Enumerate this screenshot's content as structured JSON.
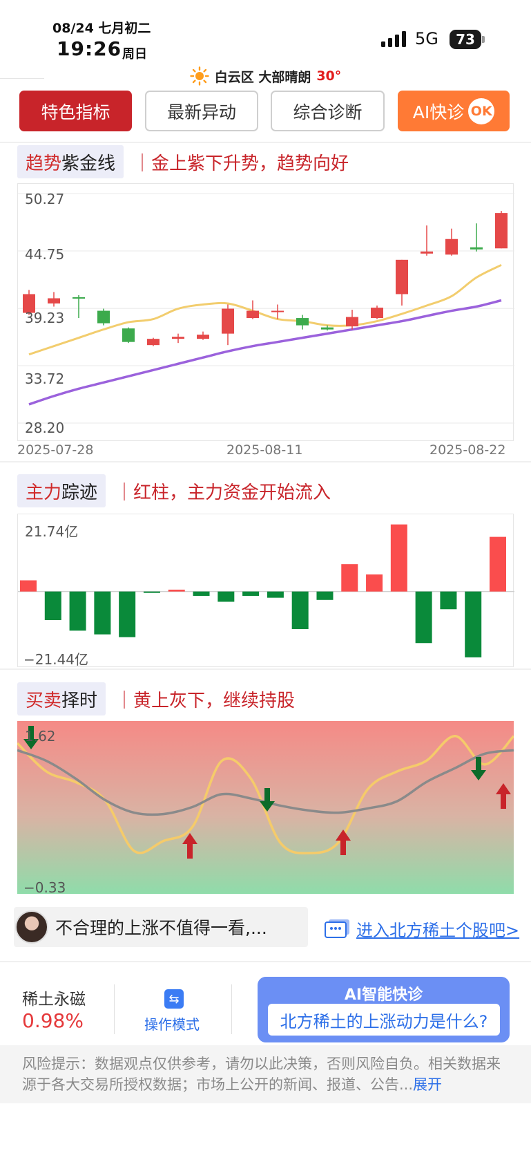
{
  "status_bar": {
    "date": "08/24 七月初二",
    "time": "19:26",
    "weekday": "周日",
    "network": "5G",
    "battery": "73"
  },
  "weather": {
    "location": "白云区 大部晴朗",
    "temperature": "30°",
    "icon": "sun-icon"
  },
  "tabs": [
    {
      "label": "特色指标",
      "active": true
    },
    {
      "label": "最新异动",
      "active": false
    },
    {
      "label": "综合诊断",
      "active": false
    },
    {
      "label": "AI快诊",
      "badge": "OK",
      "active": false
    }
  ],
  "trend": {
    "tag_red": "趋势",
    "tag_dark": "紫金线",
    "desc": "｜金上紫下升势，趋势向好",
    "y_labels": [
      "50.27",
      "44.75",
      "39.23",
      "33.72",
      "28.20"
    ],
    "x_labels": [
      "2025-07-28",
      "2025-08-11",
      "2025-08-22"
    ]
  },
  "mainforce": {
    "tag_red": "主力",
    "tag_dark": "踪迹",
    "desc": "｜红柱，主力资金开始流入",
    "y_top": "21.74亿",
    "y_bottom": "−21.44亿"
  },
  "timing": {
    "tag_red": "买卖",
    "tag_dark": "择时",
    "desc": "｜黄上灰下，继续持股",
    "y_top": "1.62",
    "y_bottom": "−0.33"
  },
  "chart_data": [
    {
      "type": "candlestick",
      "title": "趋势紫金线",
      "ylim": [
        28.2,
        50.27
      ],
      "y_ticks": [
        50.27,
        44.75,
        39.23,
        33.72,
        28.2
      ],
      "x_ticks": [
        "2025-07-28",
        "2025-08-11",
        "2025-08-22"
      ],
      "colors": {
        "up": "#e54848",
        "down": "#3caa4c",
        "gold": "#f2cd6e",
        "purple": "#9b62dc"
      },
      "candles": [
        {
          "o": 38.8,
          "c": 40.6,
          "h": 41.0,
          "l": 38.6
        },
        {
          "o": 39.7,
          "c": 40.2,
          "h": 40.8,
          "l": 39.4
        },
        {
          "o": 40.3,
          "c": 40.2,
          "h": 40.5,
          "l": 38.3
        },
        {
          "o": 39.0,
          "c": 37.8,
          "h": 39.2,
          "l": 37.6
        },
        {
          "o": 37.3,
          "c": 36.0,
          "h": 37.4,
          "l": 35.9
        },
        {
          "o": 35.7,
          "c": 36.3,
          "h": 36.4,
          "l": 35.6
        },
        {
          "o": 36.3,
          "c": 36.5,
          "h": 36.8,
          "l": 35.9
        },
        {
          "o": 36.3,
          "c": 36.7,
          "h": 37.0,
          "l": 36.2
        },
        {
          "o": 36.8,
          "c": 39.2,
          "h": 39.6,
          "l": 35.7
        },
        {
          "o": 38.3,
          "c": 39.0,
          "h": 40.0,
          "l": 38.2
        },
        {
          "o": 39.0,
          "c": 39.0,
          "h": 39.6,
          "l": 38.2
        },
        {
          "o": 38.3,
          "c": 37.6,
          "h": 38.6,
          "l": 37.2
        },
        {
          "o": 37.4,
          "c": 37.2,
          "h": 37.6,
          "l": 37.1
        },
        {
          "o": 37.5,
          "c": 38.4,
          "h": 39.1,
          "l": 37.2
        },
        {
          "o": 38.3,
          "c": 39.3,
          "h": 39.5,
          "l": 38.2
        },
        {
          "o": 40.6,
          "c": 43.9,
          "h": 43.9,
          "l": 39.5
        },
        {
          "o": 44.5,
          "c": 44.7,
          "h": 47.2,
          "l": 44.3
        },
        {
          "o": 44.4,
          "c": 45.9,
          "h": 46.9,
          "l": 44.3
        },
        {
          "o": 45.1,
          "c": 44.9,
          "h": 47.4,
          "l": 44.7
        },
        {
          "o": 45.0,
          "c": 48.4,
          "h": 48.6,
          "l": 45.0
        }
      ],
      "gold_line": [
        34.8,
        35.6,
        36.4,
        37.2,
        37.9,
        38.2,
        39.2,
        39.6,
        39.7,
        39.0,
        38.2,
        38.0,
        37.6,
        37.6,
        38.0,
        38.7,
        39.5,
        40.4,
        42.2,
        43.4
      ],
      "purple_line": [
        30.0,
        30.8,
        31.5,
        32.1,
        32.7,
        33.3,
        33.9,
        34.5,
        35.1,
        35.6,
        36.0,
        36.4,
        36.8,
        37.2,
        37.6,
        38.0,
        38.5,
        39.0,
        39.4,
        40.0
      ]
    },
    {
      "type": "bar",
      "title": "主力踪迹",
      "unit": "亿",
      "ylim": [
        -21.44,
        21.74
      ],
      "values": [
        3.6,
        -9.2,
        -12.6,
        -13.8,
        -14.7,
        -0.4,
        0.6,
        -1.4,
        -3.3,
        -1.4,
        -2.0,
        -12.1,
        -2.7,
        8.8,
        5.5,
        21.6,
        -16.6,
        -5.7,
        -21.2,
        17.6
      ],
      "colors": {
        "up": "#fa4d4d",
        "down": "#0a8a3a"
      }
    },
    {
      "type": "line",
      "title": "买卖择时",
      "ylim": [
        -0.33,
        1.62
      ],
      "series": [
        {
          "name": "",
          "color": "#f5cb6a",
          "values": [
            1.6,
            1.2,
            1.05,
            0.8,
            0.08,
            0.22,
            0.42,
            1.35,
            1.1,
            0.2,
            0.05,
            0.2,
            0.95,
            1.2,
            1.35,
            1.7,
            1.3,
            1.7
          ]
        },
        {
          "name": "",
          "color": "#8a8a8a",
          "values": [
            1.5,
            1.35,
            1.1,
            0.8,
            0.62,
            0.6,
            0.7,
            0.88,
            0.82,
            0.72,
            0.65,
            0.62,
            0.68,
            0.78,
            1.05,
            1.25,
            1.45,
            1.5
          ]
        }
      ],
      "signals": [
        {
          "type": "sell",
          "index": 0
        },
        {
          "type": "buy",
          "index": 7
        },
        {
          "type": "sell",
          "index": 10
        },
        {
          "type": "buy",
          "index": 13
        },
        {
          "type": "sell",
          "index": 19
        },
        {
          "type": "buy",
          "index": 20
        }
      ]
    }
  ],
  "comment": {
    "text": "不合理的上涨不值得一看,..."
  },
  "bar_link": "进入北方稀土个股吧>",
  "bottom": {
    "stock_name": "稀土永磁",
    "stock_pct": "0.98%",
    "mode_label": "操作模式",
    "ai_title": "AI智能快诊",
    "ai_question": "北方稀土的上涨动力是什么?"
  },
  "risk": {
    "text": "风险提示：数据观点仅供参考，请勿以此决策，否则风险自负。相关数据来源于各大交易所授权数据；市场上公开的新闻、报道、公告...",
    "expand": "展开"
  }
}
